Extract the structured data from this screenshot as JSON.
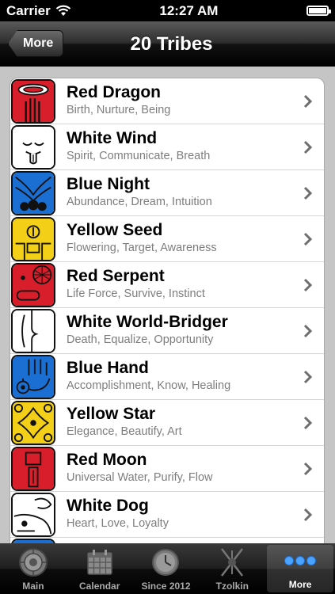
{
  "status_bar": {
    "carrier": "Carrier",
    "time": "12:27 AM"
  },
  "nav": {
    "back_label": "More",
    "title": "20 Tribes"
  },
  "tribes": [
    {
      "name": "Red Dragon",
      "keywords": "Birth, Nurture, Being",
      "color": "#d81e2a",
      "icon": "red-dragon-glyph-icon"
    },
    {
      "name": "White Wind",
      "keywords": "Spirit, Communicate, Breath",
      "color": "#ffffff",
      "icon": "white-wind-glyph-icon"
    },
    {
      "name": "Blue Night",
      "keywords": "Abundance, Dream, Intuition",
      "color": "#1c6fd2",
      "icon": "blue-night-glyph-icon"
    },
    {
      "name": "Yellow Seed",
      "keywords": "Flowering, Target, Awareness",
      "color": "#f3d017",
      "icon": "yellow-seed-glyph-icon"
    },
    {
      "name": "Red Serpent",
      "keywords": "Life Force, Survive, Instinct",
      "color": "#d81e2a",
      "icon": "red-serpent-glyph-icon"
    },
    {
      "name": "White World-Bridger",
      "keywords": "Death, Equalize, Opportunity",
      "color": "#ffffff",
      "icon": "white-world-bridger-glyph-icon"
    },
    {
      "name": "Blue Hand",
      "keywords": "Accomplishment, Know, Healing",
      "color": "#1c6fd2",
      "icon": "blue-hand-glyph-icon"
    },
    {
      "name": "Yellow Star",
      "keywords": "Elegance, Beautify, Art",
      "color": "#f3d017",
      "icon": "yellow-star-glyph-icon"
    },
    {
      "name": "Red Moon",
      "keywords": "Universal Water, Purify, Flow",
      "color": "#d81e2a",
      "icon": "red-moon-glyph-icon"
    },
    {
      "name": "White Dog",
      "keywords": "Heart, Love, Loyalty",
      "color": "#ffffff",
      "icon": "white-dog-glyph-icon"
    },
    {
      "name": "",
      "keywords": "",
      "color": "#1c6fd2",
      "icon": "blue-glyph-icon"
    }
  ],
  "tabs": [
    {
      "label": "Main",
      "icon": "mayan-calendar-icon",
      "active": false
    },
    {
      "label": "Calendar",
      "icon": "calendar-grid-icon",
      "active": false
    },
    {
      "label": "Since 2012",
      "icon": "clock-icon",
      "active": false
    },
    {
      "label": "Tzolkin",
      "icon": "tzolkin-icon",
      "active": false
    },
    {
      "label": "More",
      "icon": "more-dots-icon",
      "active": true
    }
  ]
}
